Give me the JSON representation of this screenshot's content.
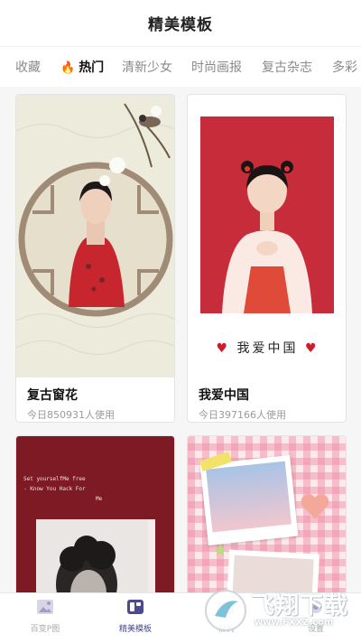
{
  "header": {
    "title": "精美模板"
  },
  "tabs": [
    {
      "label": "收藏"
    },
    {
      "label": "热门"
    },
    {
      "label": "清新少女"
    },
    {
      "label": "时尚画报"
    },
    {
      "label": "复古杂志"
    },
    {
      "label": "多彩"
    }
  ],
  "templates": [
    {
      "name": "复古窗花",
      "usage": "今日850931人使用"
    },
    {
      "name": "我爱中国",
      "usage": "今日397166人使用",
      "overlay_text": "我爱中国"
    },
    {
      "overlay_lines": [
        "Set yourselfMe free",
        "- Know You Hack For",
        "Me"
      ]
    },
    {}
  ],
  "nav": [
    {
      "label": "百变P图",
      "icon": "image-icon"
    },
    {
      "label": "精美模板",
      "icon": "template-icon"
    },
    {
      "label": "相机",
      "icon": "camera-icon"
    },
    {
      "label": "设置",
      "icon": "settings-icon"
    }
  ],
  "watermark": {
    "text": "飞翔下载",
    "url": "www.FXXZ.com"
  },
  "colors": {
    "accent": "#4b4a8c",
    "fire": "#e8412b",
    "china_red": "#c72c3a",
    "heart": "#d11a2a"
  }
}
